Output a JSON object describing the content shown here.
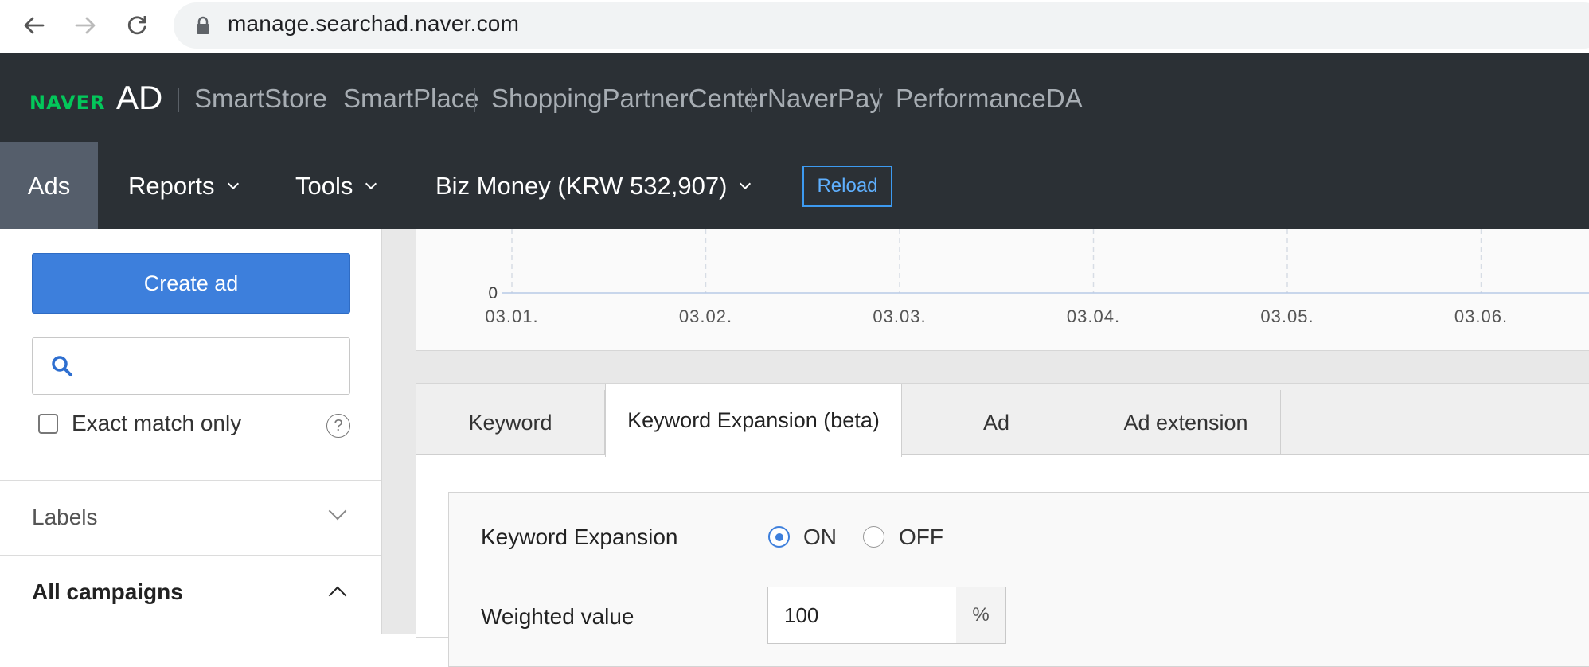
{
  "browser": {
    "url": "manage.searchad.naver.com"
  },
  "header": {
    "logo_naver": "NAVER",
    "logo_ad": "AD",
    "links": [
      "SmartStore",
      "SmartPlace",
      "ShoppingPartnerCenter",
      "NaverPay",
      "PerformanceDA"
    ]
  },
  "nav": {
    "ads": "Ads",
    "reports": "Reports",
    "tools": "Tools",
    "biz_money": "Biz Money (KRW 532,907)",
    "reload": "Reload"
  },
  "sidebar": {
    "create_ad": "Create ad",
    "search_placeholder": "",
    "exact_match": "Exact match only",
    "help": "?",
    "labels": "Labels",
    "all_campaigns": "All campaigns"
  },
  "chart_data": {
    "type": "line",
    "x": [
      "03.01.",
      "03.02.",
      "03.03.",
      "03.04.",
      "03.05.",
      "03.06."
    ],
    "y_tick": "0",
    "series": [
      {
        "values": [
          0,
          0,
          0,
          0,
          0,
          0
        ]
      }
    ]
  },
  "tabs": [
    {
      "label": "Keyword",
      "active": false
    },
    {
      "label": "Keyword Expansion (beta)",
      "active": true
    },
    {
      "label": "Ad",
      "active": false
    },
    {
      "label": "Ad extension",
      "active": false
    }
  ],
  "form": {
    "keyword_expansion_label": "Keyword Expansion",
    "on_label": "ON",
    "off_label": "OFF",
    "selected": "ON",
    "weighted_label": "Weighted value",
    "weighted_value": "100",
    "unit": "%"
  },
  "colors": {
    "header_bg": "#2b3035",
    "accent": "#3d7fdc",
    "naver_green": "#03c75a"
  }
}
